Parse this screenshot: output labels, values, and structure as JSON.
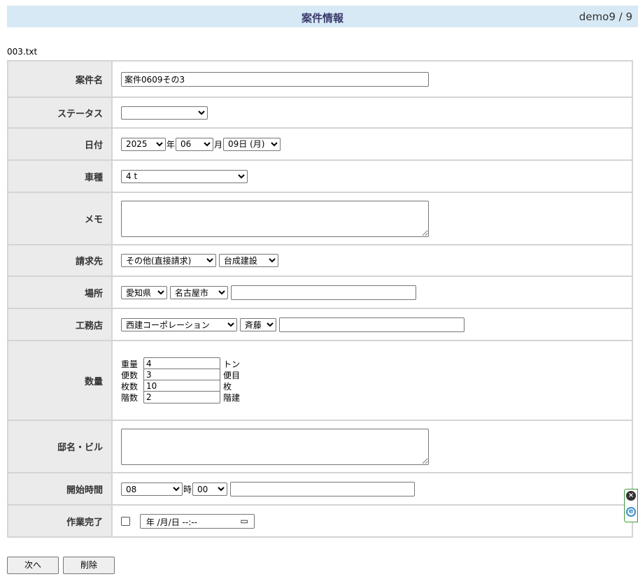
{
  "header": {
    "title": "案件情報",
    "user": "demo9 / 9"
  },
  "file": {
    "name": "003.txt"
  },
  "form": {
    "case_name": {
      "label": "案件名",
      "value": "案件0609その3"
    },
    "status": {
      "label": "ステータス",
      "value": ""
    },
    "date": {
      "label": "日付",
      "year": "2025",
      "year_unit": "年",
      "month": "06",
      "month_unit": "月",
      "day": "09日 (月)"
    },
    "vehicle": {
      "label": "車種",
      "value": "4 t"
    },
    "memo": {
      "label": "メモ",
      "value": ""
    },
    "billing": {
      "label": "請求先",
      "type": "その他(直接請求)",
      "company": "台成建設"
    },
    "location": {
      "label": "場所",
      "prefecture": "愛知県",
      "city": "名古屋市",
      "detail": ""
    },
    "contractor": {
      "label": "工務店",
      "company": "西建コーポレーション",
      "person": "斉藤",
      "detail": ""
    },
    "quantity": {
      "label": "数量",
      "rows": [
        {
          "label": "重量",
          "value": "4",
          "unit": "トン"
        },
        {
          "label": "便数",
          "value": "3",
          "unit": "便目"
        },
        {
          "label": "枚数",
          "value": "10",
          "unit": "枚"
        },
        {
          "label": "階数",
          "value": "2",
          "unit": "階建"
        }
      ]
    },
    "building": {
      "label": "邸名・ビル",
      "value": ""
    },
    "start_time": {
      "label": "開始時間",
      "hour": "08",
      "hour_unit": "時",
      "minute": "00",
      "detail": ""
    },
    "completion": {
      "label": "作業完了",
      "datetime_placeholder": "年 /月/日 --:--",
      "calendar_icon": "calendar-icon"
    }
  },
  "buttons": {
    "next": "次へ",
    "delete": "削除"
  },
  "extension": {
    "close_icon": "close-icon",
    "extension_icon": "e-icon"
  },
  "colors": {
    "header_bg": "#d6e9f5",
    "label_bg": "#ebebeb",
    "border": "#d4d4d4",
    "extension_border": "#3c9c3c"
  }
}
